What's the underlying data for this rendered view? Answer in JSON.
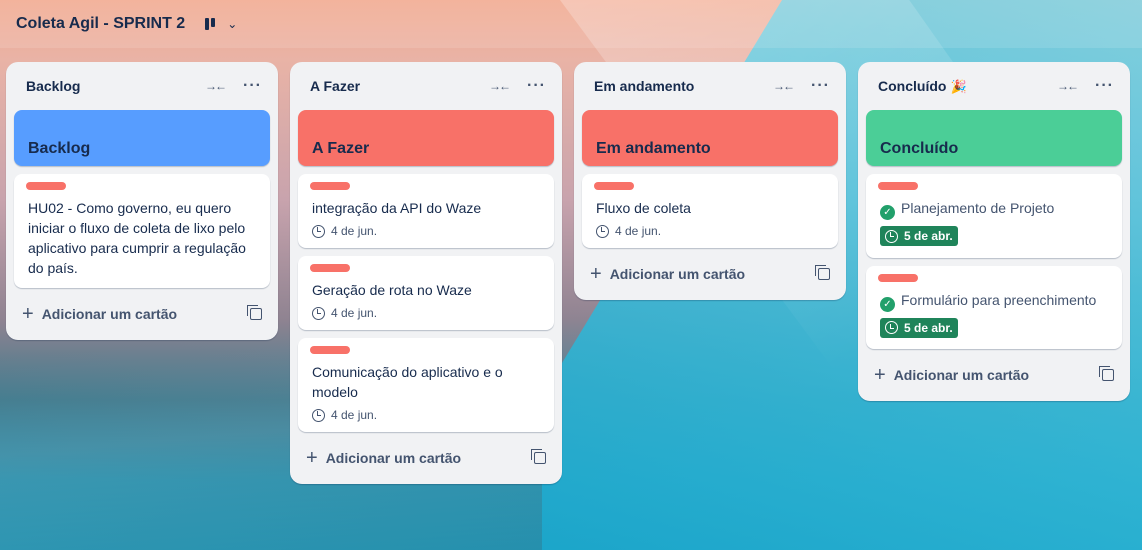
{
  "board": {
    "title": "Coleta Agil - SPRINT 2",
    "view_chevron": "⌄"
  },
  "colors": {
    "backlog_cover": "#579dff",
    "todo_cover": "#f87168",
    "doing_cover": "#f87168",
    "done_cover": "#4bce97",
    "label_red": "#f87168",
    "due_complete": "#1f845a"
  },
  "lists": [
    {
      "title": "Backlog",
      "cover": "Backlog",
      "cards": [
        {
          "text": "HU02 - Como governo, eu quero iniciar o fluxo de coleta de lixo pelo aplicativo para cumprir a regulação do país."
        }
      ],
      "add_label": "Adicionar um cartão"
    },
    {
      "title": "A Fazer",
      "cover": "A Fazer",
      "cards": [
        {
          "text": "integração da API do Waze",
          "due": "4 de jun."
        },
        {
          "text": "Geração de rota no Waze",
          "due": "4 de jun."
        },
        {
          "text": "Comunicação do aplicativo e o modelo",
          "due": "4 de jun."
        }
      ],
      "add_label": "Adicionar um cartão"
    },
    {
      "title": "Em andamento",
      "cover": "Em andamento",
      "cards": [
        {
          "text": "Fluxo de coleta",
          "due": "4 de jun."
        }
      ],
      "add_label": "Adicionar um cartão"
    },
    {
      "title": "Concluído",
      "title_emoji": "🎉",
      "cover": "Concluído",
      "cards": [
        {
          "text": "Planejamento de Projeto",
          "due": "5 de abr."
        },
        {
          "text": "Formulário para preenchimento",
          "due": "5 de abr."
        }
      ],
      "add_label": "Adicionar um cartão"
    }
  ],
  "icons": {
    "collapse": "→←",
    "more": "···",
    "plus": "+",
    "check": "✓",
    "template": "template-icon",
    "clock": "clock-icon"
  }
}
